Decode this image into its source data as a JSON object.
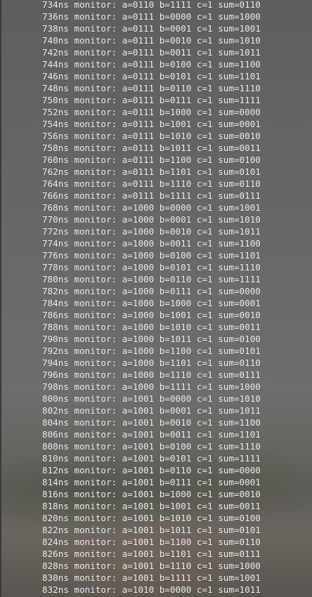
{
  "terminal": {
    "lines": [
      "734ns monitor: a=0110 b=1111 c=1 sum=0110",
      "736ns monitor: a=0111 b=0000 c=1 sum=1000",
      "738ns monitor: a=0111 b=0001 c=1 sum=1001",
      "740ns monitor: a=0111 b=0010 c=1 sum=1010",
      "742ns monitor: a=0111 b=0011 c=1 sum=1011",
      "744ns monitor: a=0111 b=0100 c=1 sum=1100",
      "746ns monitor: a=0111 b=0101 c=1 sum=1101",
      "748ns monitor: a=0111 b=0110 c=1 sum=1110",
      "750ns monitor: a=0111 b=0111 c=1 sum=1111",
      "752ns monitor: a=0111 b=1000 c=1 sum=0000",
      "754ns monitor: a=0111 b=1001 c=1 sum=0001",
      "756ns monitor: a=0111 b=1010 c=1 sum=0010",
      "758ns monitor: a=0111 b=1011 c=1 sum=0011",
      "760ns monitor: a=0111 b=1100 c=1 sum=0100",
      "762ns monitor: a=0111 b=1101 c=1 sum=0101",
      "764ns monitor: a=0111 b=1110 c=1 sum=0110",
      "766ns monitor: a=0111 b=1111 c=1 sum=0111",
      "768ns monitor: a=1000 b=0000 c=1 sum=1001",
      "770ns monitor: a=1000 b=0001 c=1 sum=1010",
      "772ns monitor: a=1000 b=0010 c=1 sum=1011",
      "774ns monitor: a=1000 b=0011 c=1 sum=1100",
      "776ns monitor: a=1000 b=0100 c=1 sum=1101",
      "778ns monitor: a=1000 b=0101 c=1 sum=1110",
      "780ns monitor: a=1000 b=0110 c=1 sum=1111",
      "782ns monitor: a=1000 b=0111 c=1 sum=0000",
      "784ns monitor: a=1000 b=1000 c=1 sum=0001",
      "786ns monitor: a=1000 b=1001 c=1 sum=0010",
      "788ns monitor: a=1000 b=1010 c=1 sum=0011",
      "790ns monitor: a=1000 b=1011 c=1 sum=0100",
      "792ns monitor: a=1000 b=1100 c=1 sum=0101",
      "794ns monitor: a=1000 b=1101 c=1 sum=0110",
      "796ns monitor: a=1000 b=1110 c=1 sum=0111",
      "798ns monitor: a=1000 b=1111 c=1 sum=1000",
      "800ns monitor: a=1001 b=0000 c=1 sum=1010",
      "802ns monitor: a=1001 b=0001 c=1 sum=1011",
      "804ns monitor: a=1001 b=0010 c=1 sum=1100",
      "806ns monitor: a=1001 b=0011 c=1 sum=1101",
      "808ns monitor: a=1001 b=0100 c=1 sum=1110",
      "810ns monitor: a=1001 b=0101 c=1 sum=1111",
      "812ns monitor: a=1001 b=0110 c=1 sum=0000",
      "814ns monitor: a=1001 b=0111 c=1 sum=0001",
      "816ns monitor: a=1001 b=1000 c=1 sum=0010",
      "818ns monitor: a=1001 b=1001 c=1 sum=0011",
      "820ns monitor: a=1001 b=1010 c=1 sum=0100",
      "822ns monitor: a=1001 b=1011 c=1 sum=0101",
      "824ns monitor: a=1001 b=1100 c=1 sum=0110",
      "826ns monitor: a=1001 b=1101 c=1 sum=0111",
      "828ns monitor: a=1001 b=1110 c=1 sum=1000",
      "830ns monitor: a=1001 b=1111 c=1 sum=1001",
      "832ns monitor: a=1010 b=0000 c=1 sum=1011"
    ]
  },
  "colors": {
    "text": "#f2f2f2",
    "background": "#646464"
  }
}
